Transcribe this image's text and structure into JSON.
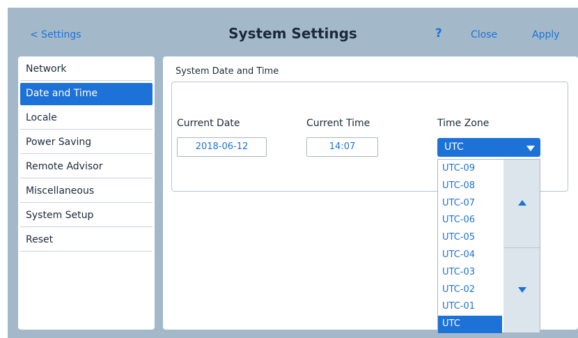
{
  "header": {
    "back_label": "< Settings",
    "title": "System Settings",
    "help_label": "?",
    "close_label": "Close",
    "apply_label": "Apply"
  },
  "sidebar": {
    "items": [
      {
        "label": "Network"
      },
      {
        "label": "Date and Time",
        "active": true
      },
      {
        "label": "Locale"
      },
      {
        "label": "Power Saving"
      },
      {
        "label": "Remote Advisor"
      },
      {
        "label": "Miscellaneous"
      },
      {
        "label": "System Setup"
      },
      {
        "label": "Reset"
      }
    ]
  },
  "main": {
    "group_title": "System Date and Time",
    "current_date": {
      "label": "Current Date",
      "value": "2018-06-12"
    },
    "current_time": {
      "label": "Current Time",
      "value": "14:07"
    },
    "time_zone": {
      "label": "Time Zone",
      "selected": "UTC",
      "options": [
        "UTC-09",
        "UTC-08",
        "UTC-07",
        "UTC-06",
        "UTC-05",
        "UTC-04",
        "UTC-03",
        "UTC-02",
        "UTC-01",
        "UTC"
      ]
    }
  },
  "colors": {
    "accent": "#1d72d8",
    "frame": "#a3b8c8",
    "panel": "#ffffff",
    "text": "#1b2a3a"
  },
  "icons": {
    "dropdown_arrow": "chevron-down-icon",
    "scroll_up": "triangle-up-icon",
    "scroll_down": "triangle-down-icon"
  }
}
